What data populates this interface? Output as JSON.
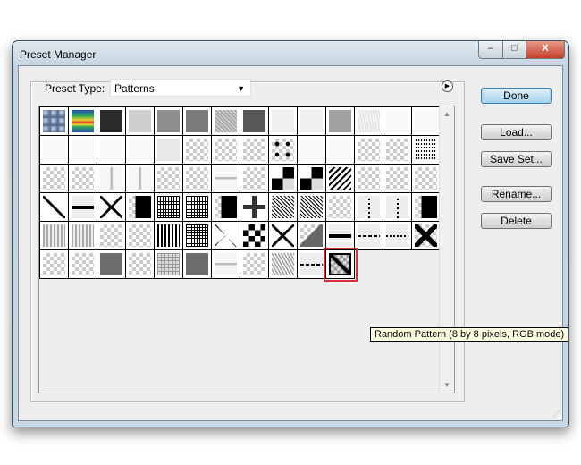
{
  "window": {
    "title": "Preset Manager",
    "minimize": "–",
    "maximize": "□",
    "close": "X"
  },
  "preset_type": {
    "label": "Preset Type:",
    "value": "Patterns"
  },
  "buttons": {
    "done": "Done",
    "load": "Load...",
    "save_set": "Save Set...",
    "rename": "Rename...",
    "delete": "Delete"
  },
  "tooltip": "Random Pattern (8 by 8 pixels, RGB mode)",
  "selected_index": 80,
  "patterns": [
    "bubbles",
    "rainbow",
    "dark",
    "light",
    "mid",
    "mid2",
    "noise",
    "darkgray",
    "verylight",
    "verylight",
    "midlight",
    "noiselight",
    "white",
    "white",
    "white",
    "white",
    "white",
    "white",
    "lightgray",
    "chk",
    "chk",
    "chk",
    "checkerdark",
    "white",
    "white",
    "chk",
    "chk",
    "dots",
    "chk",
    "chk",
    "vline",
    "vline",
    "chk",
    "chk",
    "hline",
    "chk",
    "blackchecker",
    "blackchecker",
    "diagbold",
    "chk",
    "chk",
    "chk",
    "diagx",
    "dash",
    "x",
    "blackblock",
    "grid",
    "grid",
    "blackblock",
    "cross",
    "diagfine",
    "diagfine",
    "chk",
    "vdash",
    "vdash",
    "blackblock",
    "maze",
    "maze",
    "chk",
    "chk",
    "stripesv",
    "grid",
    "diamond",
    "checkerbold",
    "x",
    "grayblock",
    "dash",
    "hdash",
    "hdot",
    "xbold",
    "chk",
    "chk",
    "graydark",
    "chk",
    "gridlight",
    "graydark",
    "hline",
    "chk",
    "diaglight",
    "hdash",
    "random"
  ]
}
